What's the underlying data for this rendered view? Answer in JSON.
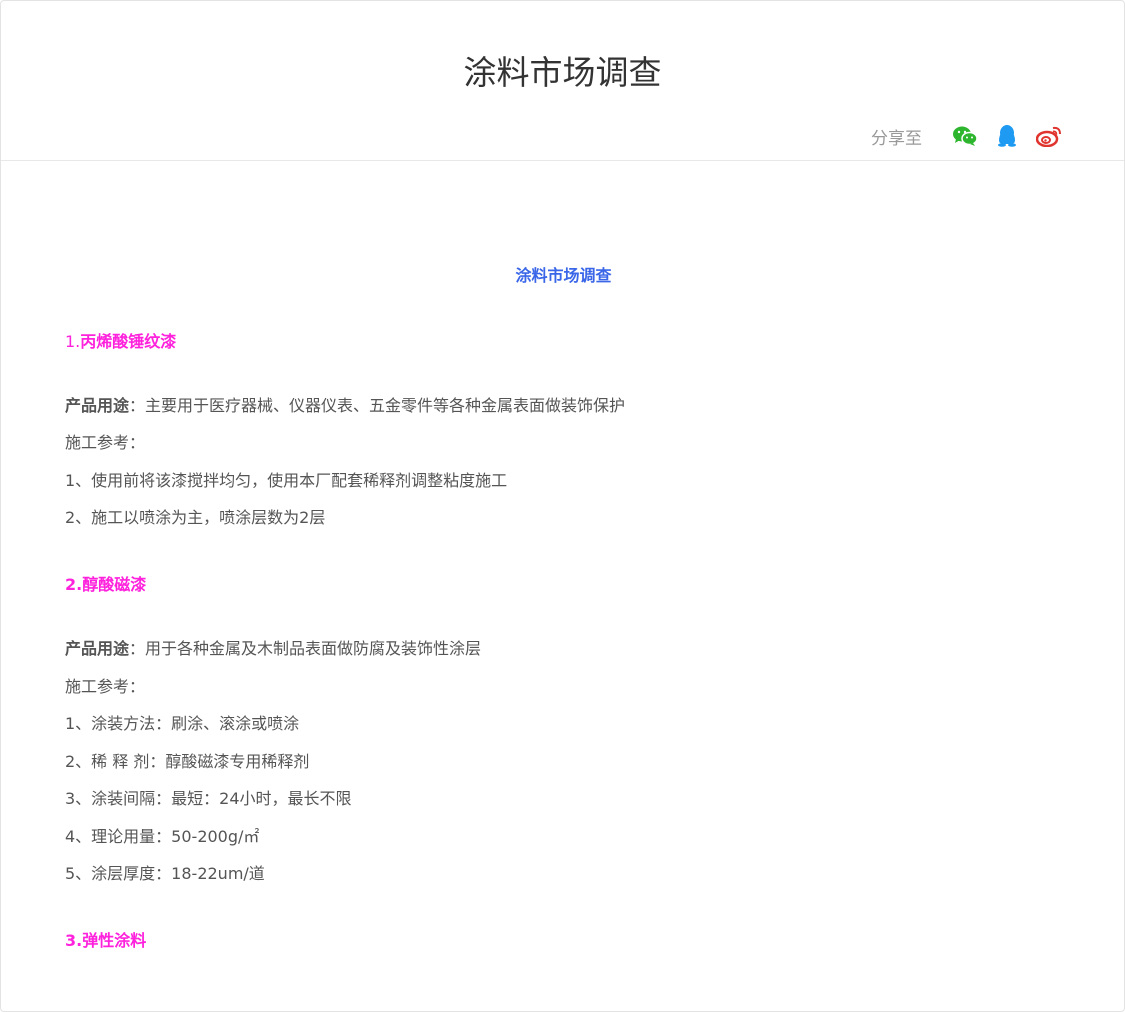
{
  "header": {
    "title": "涂料市场调查",
    "share_label": "分享至",
    "share_icons": [
      "wechat-icon",
      "qq-icon",
      "weibo-icon"
    ],
    "colors": {
      "wechat": "#2db52d",
      "qq": "#1e9af2",
      "weibo": "#e0342f"
    }
  },
  "article": {
    "subtitle": "涂料市场调查",
    "sections": [
      {
        "number": "1.",
        "heading": "丙烯酸锤纹漆",
        "usage_label": "产品用途",
        "usage_text": "：主要用于医疗器械、仪器仪表、五金零件等各种金属表面做装饰保护",
        "guide_label": "施工参考：",
        "items": [
          "1、使用前将该漆搅拌均匀，使用本厂配套稀释剂调整粘度施工",
          "2、施工以喷涂为主，喷涂层数为2层"
        ]
      },
      {
        "number": "2.",
        "heading": "醇酸磁漆",
        "usage_label": "产品用途",
        "usage_text": "：用于各种金属及木制品表面做防腐及装饰性涂层",
        "guide_label": "施工参考：",
        "items": [
          "1、涂装方法：刷涂、滚涂或喷涂",
          "2、稀 释 剂：醇酸磁漆专用稀释剂",
          "3、涂装间隔：最短：24小时，最长不限",
          "4、理论用量：50-200g/㎡",
          "5、涂层厚度：18-22um/道"
        ]
      },
      {
        "number": "3.",
        "heading": "弹性涂料"
      }
    ],
    "colors": {
      "heading": "#ff22dd",
      "subtitle": "#3a66e8",
      "text": "#555555"
    }
  }
}
